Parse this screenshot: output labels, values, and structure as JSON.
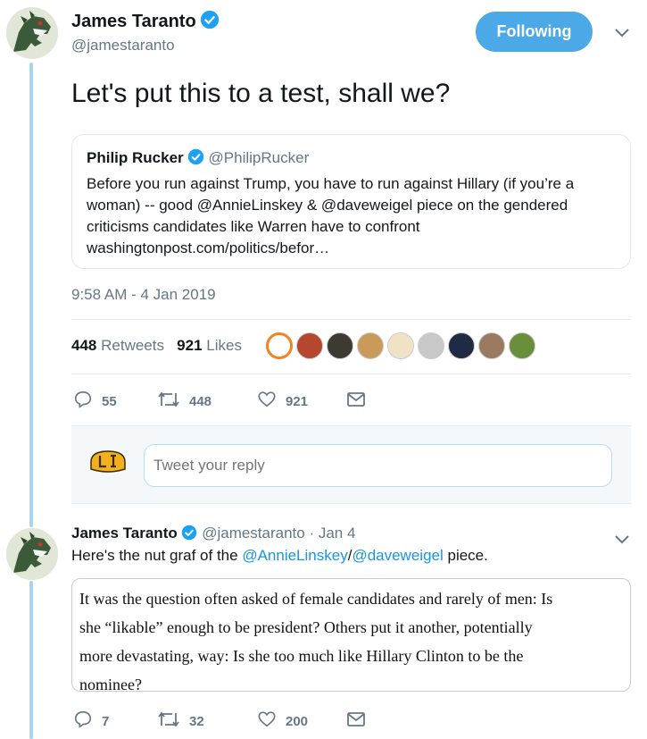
{
  "tweet": {
    "author_name": "James Taranto",
    "author_handle": "@jamestaranto",
    "follow_label": "Following",
    "text": "Let's put this to a test, shall we?",
    "timestamp": "9:58 AM - 4 Jan 2019",
    "retweets_count": "448",
    "retweets_label": "Retweets",
    "likes_count": "921",
    "likes_label": "Likes",
    "actions": {
      "replies": "55",
      "retweets": "448",
      "likes": "921"
    }
  },
  "quoted": {
    "name": "Philip Rucker",
    "handle": "@PhilipRucker",
    "text_lines": [
      "Before you run against Trump, you have to run against Hillary (if you’re a",
      "woman) -- good @AnnieLinskey & @daveweigel piece on the gendered",
      "criticisms candidates like Warren have to confront",
      "washingtonpost.com/politics/befor…"
    ]
  },
  "reply": {
    "placeholder": "Tweet your reply"
  },
  "tweet2": {
    "author_name": "James Taranto",
    "author_handle": "@jamestaranto",
    "date": "· Jan 4",
    "text_prefix": "Here's the nut graf of the ",
    "link1": "@AnnieLinskey",
    "slash": "/",
    "link2": "@daveweigel",
    "text_suffix": " piece.",
    "image_lines": [
      "It was the question often asked of female candidates and rarely of men: Is",
      "she “likable” enough to be president? Others put it another, potentially",
      "more devastating, way: Is she too much like Hillary Clinton to be the",
      "nominee?"
    ],
    "actions": {
      "replies": "7",
      "retweets": "32",
      "likes": "200"
    }
  },
  "colors": {
    "accent": "#1b95e0",
    "follow_bg": "#4aa9e6",
    "thread_line": "#a8d4ef"
  },
  "icons": [
    "verified-badge-icon",
    "chevron-down-icon",
    "reply-icon",
    "retweet-icon",
    "heart-icon",
    "dm-envelope-icon"
  ]
}
